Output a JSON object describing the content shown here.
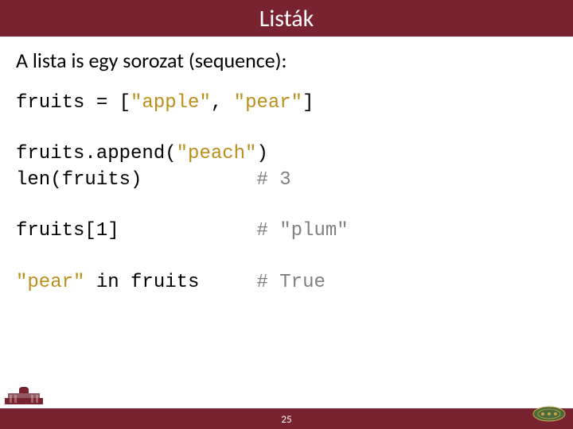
{
  "title": "Listák",
  "intro": "A lista is egy sorozat (sequence):",
  "code": {
    "l1_a": "fruits = [",
    "l1_s1": "\"apple\"",
    "l1_b": ", ",
    "l1_s2": "\"pear\"",
    "l1_c": "]",
    "l2_a": "fruits.append(",
    "l2_s": "\"peach\"",
    "l2_b": ")",
    "l3_a": "len(fruits)          ",
    "l3_c": "# 3",
    "l4_a": "fruits[1]            ",
    "l4_c": "# \"plum\"",
    "l5_s": "\"pear\"",
    "l5_a": " in fruits     ",
    "l5_c": "# True"
  },
  "page_number": "25"
}
